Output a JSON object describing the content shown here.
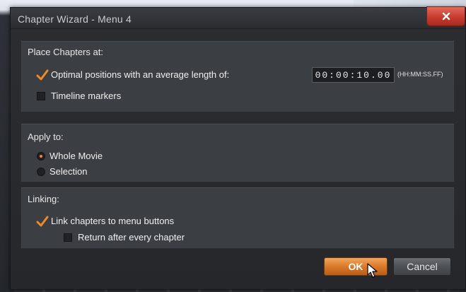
{
  "window": {
    "title": "Chapter Wizard - Menu 4"
  },
  "place_chapters": {
    "label": "Place Chapters at:",
    "optimal_label": "Optimal positions with an average length of:",
    "optimal_checked": true,
    "time_value": "00:00:10.00",
    "time_format": "(HH:MM:SS.FF)",
    "timeline_markers_label": "Timeline markers",
    "timeline_markers_checked": false
  },
  "apply_to": {
    "label": "Apply to:",
    "whole_movie_label": "Whole Movie",
    "selection_label": "Selection",
    "selected": "Whole Movie"
  },
  "linking": {
    "label": "Linking:",
    "link_chapters_label": "Link chapters to menu buttons",
    "link_chapters_checked": true,
    "return_after_label": "Return after every chapter",
    "return_after_checked": false
  },
  "buttons": {
    "ok_label": "OK",
    "cancel_label": "Cancel"
  },
  "colors": {
    "accent": "#f08a24",
    "close_red": "#c63c2e"
  },
  "icons": [
    "close-icon",
    "checkmark-icon",
    "mouse-cursor-icon"
  ]
}
